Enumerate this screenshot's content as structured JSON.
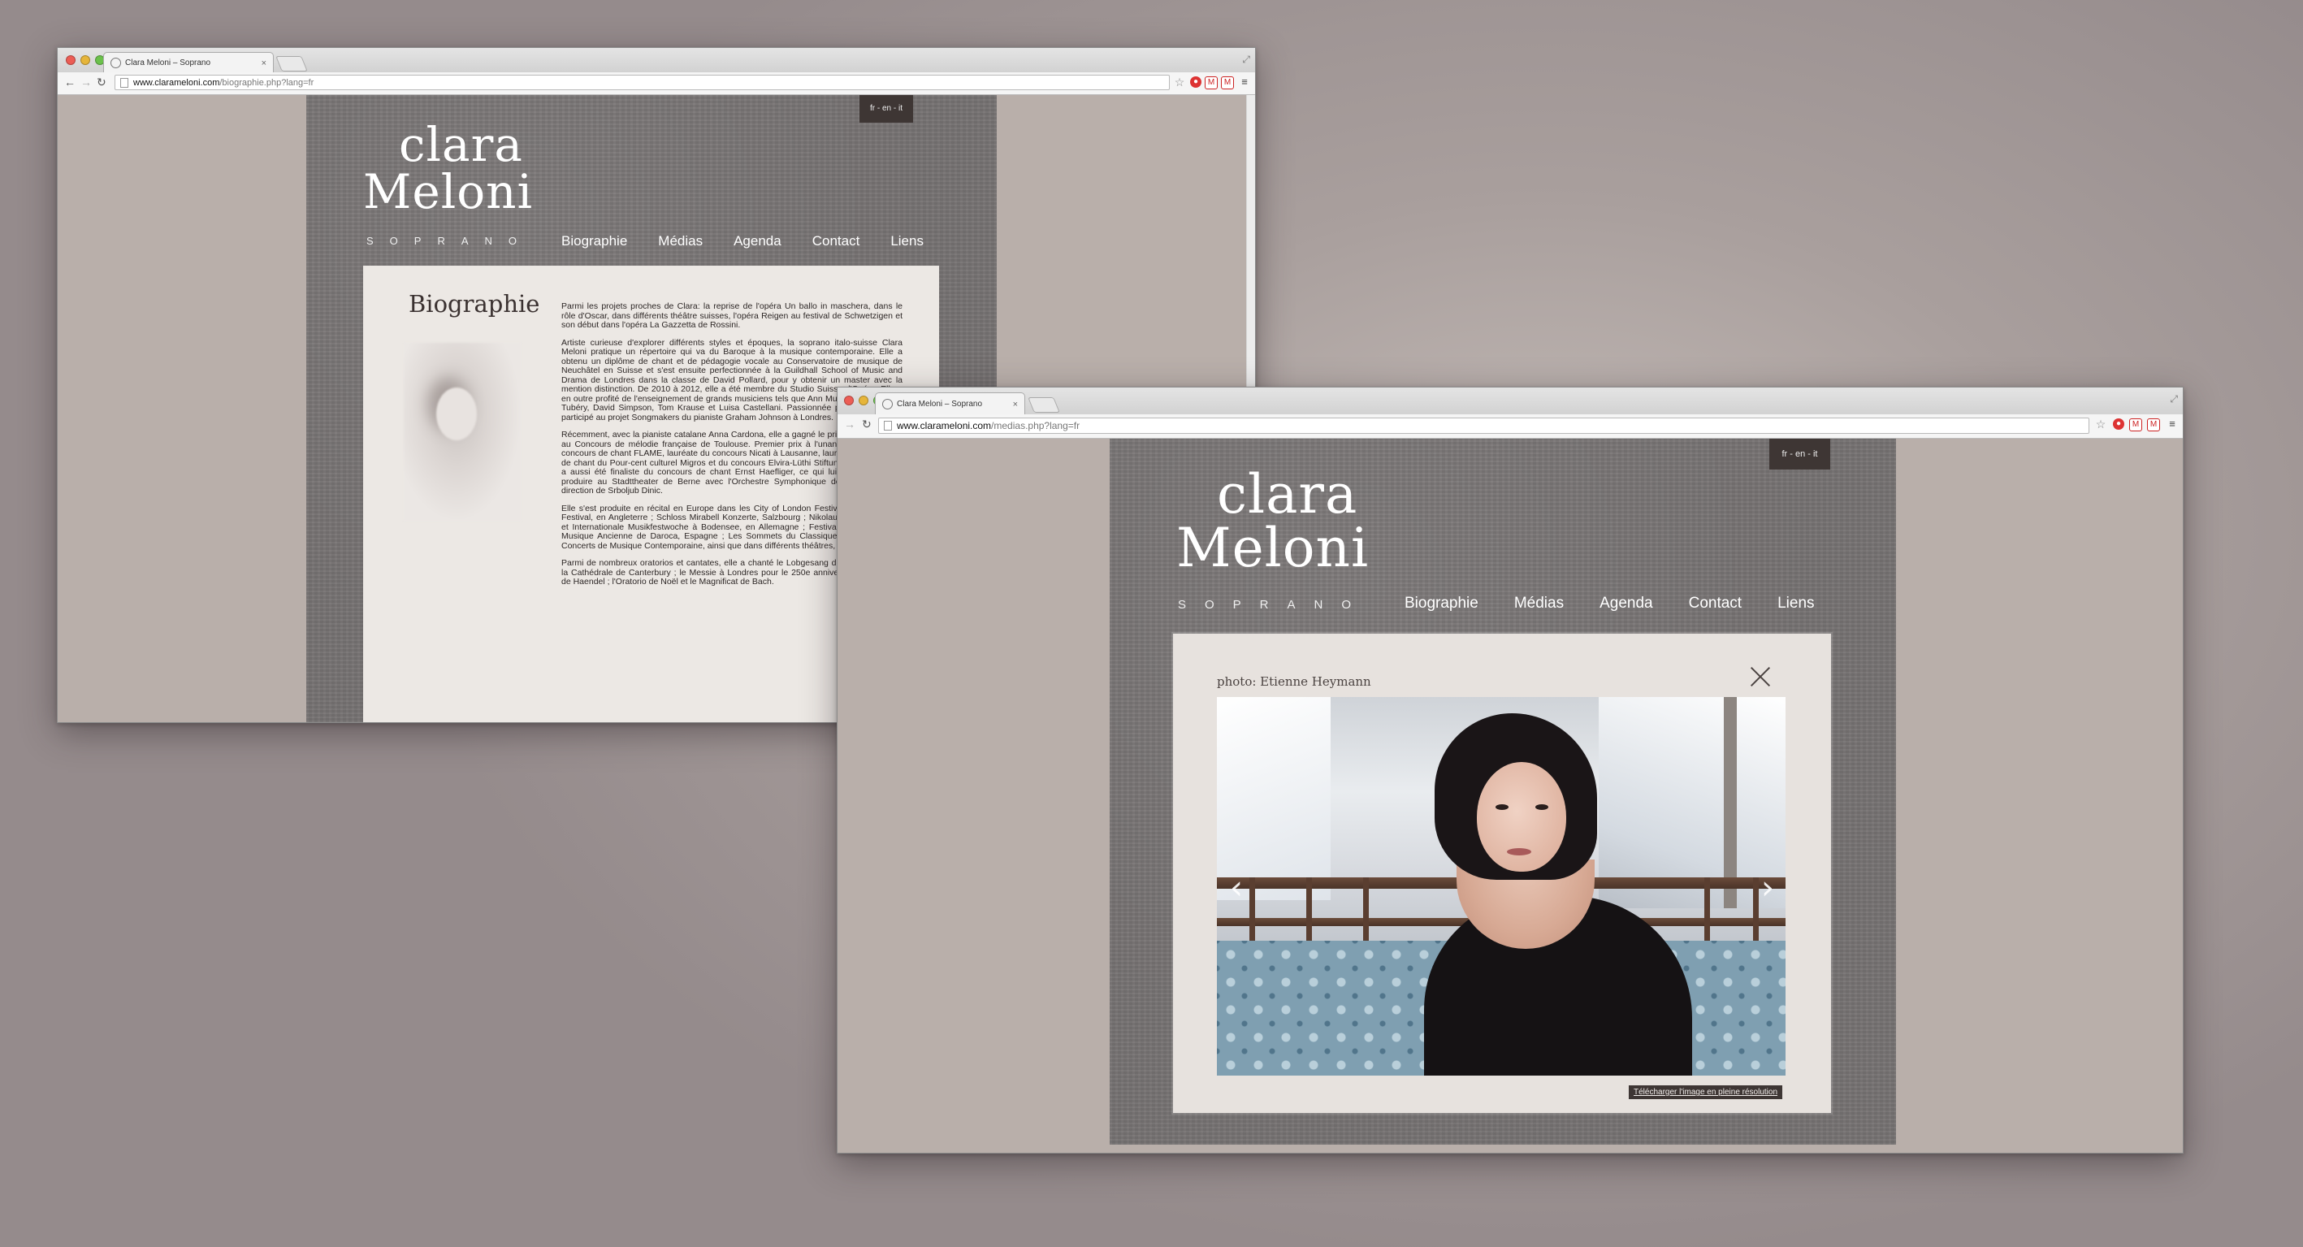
{
  "site": {
    "logo_line1": "clara",
    "logo_line2": "Meloni",
    "tagline": "SOPRANO",
    "language_switch": "fr - en - it",
    "nav": [
      "Biographie",
      "Médias",
      "Agenda",
      "Contact",
      "Liens"
    ]
  },
  "window_biography": {
    "tab_title": "Clara Meloni – Soprano",
    "url_domain": "www.clarameloni.com",
    "url_path": "/biographie.php?lang=fr",
    "page_heading": "Biographie",
    "paragraphs": [
      "Parmi les projets proches de Clara: la reprise de l'opéra Un ballo in maschera, dans le rôle d'Oscar, dans différents théâtre suisses, l'opéra Reigen au festival de Schwetzigen et son début dans l'opéra La Gazzetta de Rossini.",
      "Artiste curieuse d'explorer différents styles et époques, la soprano italo-suisse Clara Meloni pratique un répertoire qui va du Baroque à la musique contemporaine. Elle a obtenu un diplôme de chant et de pédagogie vocale au Conservatoire de musique de Neuchâtel en Suisse et s'est ensuite perfectionnée à la Guildhall School of Music and Drama de Londres dans la classe de David Pollard, pour y obtenir un master avec la mention distinction. De 2010 à 2012, elle a été membre du Studio Suisse d'Opéra. Elle a en outre profité de l'enseignement de grands musiciens tels que Ann Murray, Crook, Jean Tubéry, David Simpson, Tom Krause et Luisa Castellani. Passionnée par le lied, elle a participé au projet Songmakers du pianiste Graham Johnson à Londres.",
      "Récemment, avec la pianiste catalane Anna Cardona, elle a gagné le prix du meilleur duo au Concours de mélodie française de Toulouse. Premier prix à l'unanimité du XXIème concours de chant FLAME, lauréate du concours Nicati à Lausanne, lauréate du concours de chant du Pour-cent culturel Migros et du concours Elvira-Lüthi Stiftung (Suisse), Clara a aussi été finaliste du concours de chant Ernst Haefliger, ce qui lui a permis de se produire au Stadttheater de Berne avec l'Orchestre Symphonique de Berne sous la direction de Srboljub Dinic.",
      "Elle s'est produite en récital en Europe dans les City of London Festival, Oxford Lieder Festival, en Angleterre ; Schloss Mirabell Konzerte, Salzbourg ; Nikolauskirche à Leipzig et Internationale Musikfestwoche à Bodensee, en Allemagne ; Festival International de Musique Ancienne de Daroca, Espagne ; Les Sommets du Classique, Usinesonore et Concerts de Musique Contemporaine, ainsi que dans différents théâtres, en Suisse.",
      "Parmi de nombreux oratorios et cantates, elle a chanté le Lobgesang de Mendelssohn à la Cathédrale de Canterbury ; le Messie à Londres pour le 250e anniversaire de la mort de Haendel ; l'Oratorio de Noël et le Magnificat de Bach."
    ]
  },
  "window_medias": {
    "tab_title": "Clara Meloni – Soprano",
    "url_domain": "www.clarameloni.com",
    "url_path": "/medias.php?lang=fr",
    "photo_credit": "photo: Etienne Heymann",
    "download_link": "Télécharger l'image en pleine résolution"
  },
  "icons": {
    "back": "back-arrow-icon",
    "forward": "forward-arrow-icon",
    "reload": "reload-icon",
    "bookmark": "star-icon",
    "close": "close-icon",
    "prev": "chevron-left-icon",
    "next": "chevron-right-icon"
  },
  "colors": {
    "background": "#a99f9d",
    "site_panel": "#777373",
    "content_panel": "#ece8e4",
    "lang_badge": "#3e3634"
  }
}
